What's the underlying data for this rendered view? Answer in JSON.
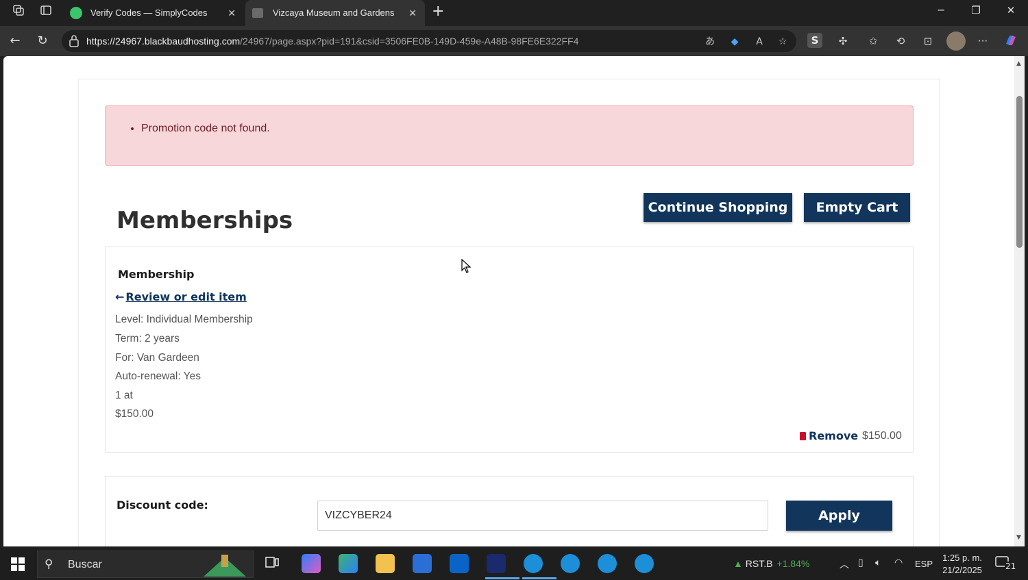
{
  "browser": {
    "tabs": [
      {
        "label": "Verify Codes — SimplyCodes",
        "active": false
      },
      {
        "label": "Vizcaya Museum and Gardens",
        "active": true
      }
    ],
    "url_host": "https://24967.blackbaudhosting.com",
    "url_path": "/24967/page.aspx?pid=191&csid=3506FE0B-149D-459e-A48B-98FE6E322FF4"
  },
  "page": {
    "alert_message": "Promotion code not found.",
    "title": "Memberships",
    "continue_shopping_label": "Continue Shopping",
    "empty_cart_label": "Empty Cart",
    "item": {
      "type": "Membership",
      "review_link": "Review or edit item",
      "details": [
        "Level: Individual Membership",
        "Term: 2 years",
        "For: Van Gardeen",
        "Auto-renewal: Yes",
        "1 at",
        "$150.00"
      ],
      "remove_label": "Remove",
      "total": "$150.00"
    },
    "discount": {
      "label": "Discount code:",
      "value": "VIZCYBER24",
      "apply_label": "Apply"
    }
  },
  "taskbar": {
    "search_placeholder": "Buscar",
    "stock_symbol": "RST.B",
    "stock_change": "+1.84%",
    "language": "ESP",
    "time": "1:25 p. m.",
    "date": "21/2/2025",
    "notifications": "21"
  },
  "colors": {
    "primary": "#12355b",
    "alert_bg": "#f8d7da",
    "alert_text": "#6b2027",
    "remove_icon": "#c8102e"
  }
}
